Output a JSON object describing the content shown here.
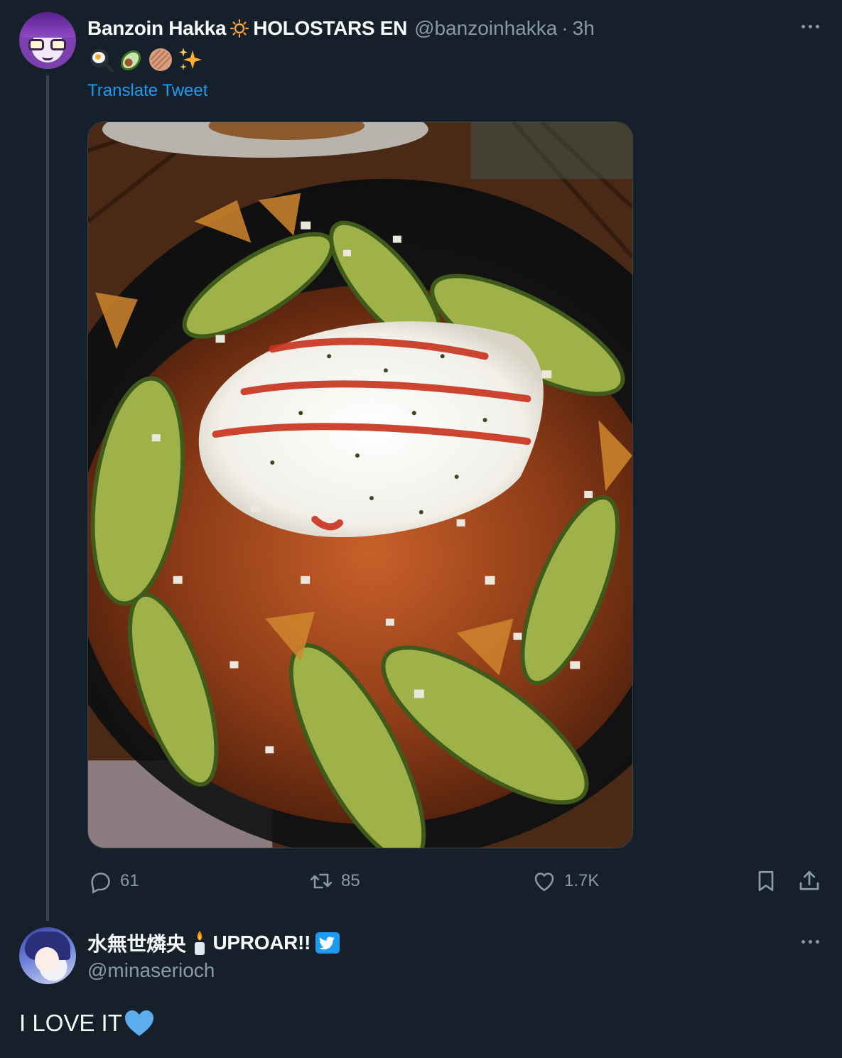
{
  "tweet": {
    "author_name": "Banzoin Hakka",
    "affiliation": "HOLOSTARS EN",
    "handle": "@banzoinhakka",
    "separator": "·",
    "time": "3h",
    "emoji_text": [
      "fried-egg",
      "avocado",
      "flatbread",
      "sparkles"
    ],
    "translate_label": "Translate Tweet",
    "photo_alt": "food photo",
    "actions": {
      "reply_count": "61",
      "retweet_count": "85",
      "like_count": "1.7K"
    }
  },
  "reply": {
    "author_name": "水無世燐央",
    "affiliation": "UPROAR!!",
    "handle": "@minaserioch",
    "text": "I LOVE IT",
    "verified": true
  },
  "icons": {
    "reply": "reply-bubble-icon",
    "retweet": "retweet-icon",
    "like": "heart-outline-icon",
    "bookmark": "bookmark-icon",
    "share": "share-upload-icon",
    "more": "more-dots-icon"
  },
  "colors": {
    "background": "#15202b",
    "text": "#f7f9f9",
    "muted": "#8b98a5",
    "link": "#1d9bf0",
    "border": "#38444d"
  }
}
